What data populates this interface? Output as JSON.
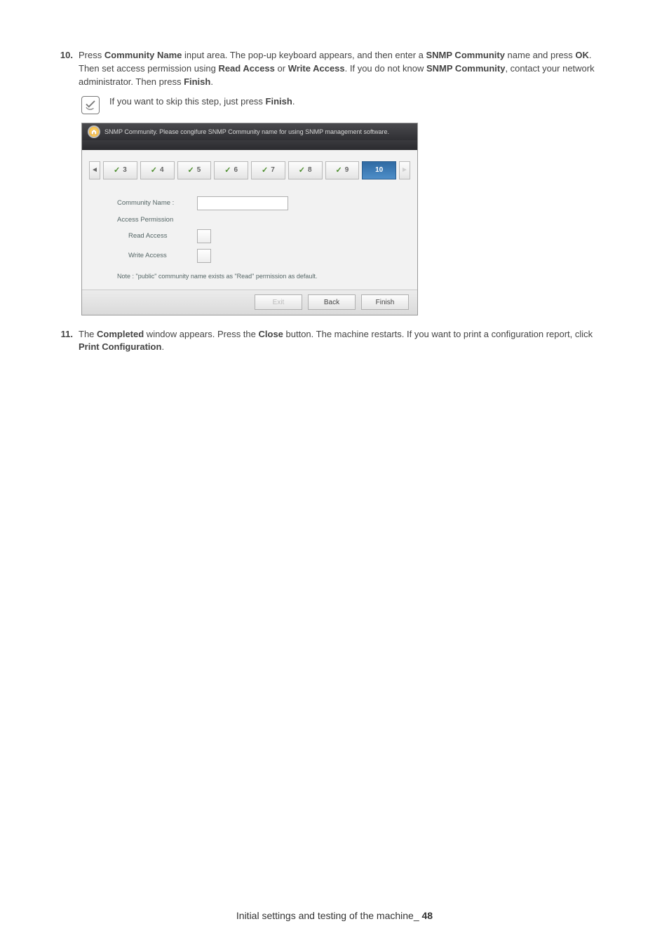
{
  "step10": {
    "number": "10.",
    "text_parts": {
      "p1": "Press ",
      "b1": "Community Name",
      "p2": " input area. The pop-up keyboard appears, and then enter a ",
      "b2": "SNMP Community",
      "p3": " name and press ",
      "b3": "OK",
      "p4": ". Then set access permission using ",
      "b4": "Read Access",
      "p5": " or ",
      "b5": "Write Access",
      "p6": ". If you do not know ",
      "b6": "SNMP Community",
      "p7": ", contact your network administrator. Then press ",
      "b7": "Finish",
      "p8": "."
    }
  },
  "note": {
    "p1": "If you want to skip this step, just press ",
    "b1": "Finish",
    "p2": "."
  },
  "wizard": {
    "header": "SNMP Community. Please congifure SNMP Community name for using SNMP management software.",
    "tabs": [
      "3",
      "4",
      "5",
      "6",
      "7",
      "8",
      "9",
      "10"
    ],
    "active_tab": "10",
    "form": {
      "community_label": "Community Name :",
      "access_label": "Access Permission",
      "read_label": "Read Access",
      "write_label": "Write Access",
      "note": "Note : \"public\" community name exists as \"Read\" permission as default."
    },
    "buttons": {
      "exit": "Exit",
      "back": "Back",
      "finish": "Finish"
    }
  },
  "step11": {
    "number": "11.",
    "text_parts": {
      "p1": "The ",
      "b1": "Completed",
      "p2": " window appears. Press the ",
      "b2": "Close",
      "p3": " button. The machine restarts. If you want to print a configuration report, click ",
      "b3": "Print Configuration",
      "p4": "."
    }
  },
  "footer": {
    "text": "Initial settings and testing of the machine",
    "sep": "_ ",
    "page": "48"
  }
}
